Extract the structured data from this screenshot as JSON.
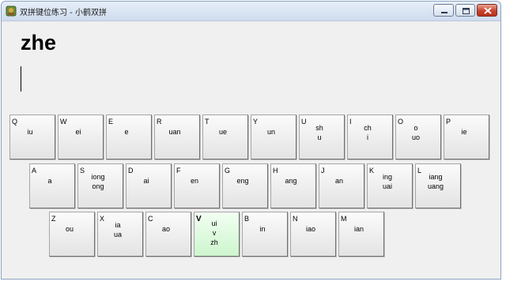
{
  "window": {
    "title": "双拼键位练习 - 小鹤双拼"
  },
  "practice": {
    "target_syllable": "zhe",
    "input_value": ""
  },
  "keyboard": {
    "active_key": "V",
    "rows": [
      [
        {
          "letter": "Q",
          "finals": [
            "iu"
          ]
        },
        {
          "letter": "W",
          "finals": [
            "ei"
          ]
        },
        {
          "letter": "E",
          "finals": [
            "e"
          ]
        },
        {
          "letter": "R",
          "finals": [
            "uan"
          ]
        },
        {
          "letter": "T",
          "finals": [
            "ue"
          ]
        },
        {
          "letter": "Y",
          "finals": [
            "un"
          ]
        },
        {
          "letter": "U",
          "finals": [
            "sh",
            "u"
          ]
        },
        {
          "letter": "I",
          "finals": [
            "ch",
            "i"
          ]
        },
        {
          "letter": "O",
          "finals": [
            "o",
            "uo"
          ]
        },
        {
          "letter": "P",
          "finals": [
            "ie"
          ]
        }
      ],
      [
        {
          "letter": "A",
          "finals": [
            "a"
          ]
        },
        {
          "letter": "S",
          "finals": [
            "iong",
            "ong"
          ]
        },
        {
          "letter": "D",
          "finals": [
            "ai"
          ]
        },
        {
          "letter": "F",
          "finals": [
            "en"
          ]
        },
        {
          "letter": "G",
          "finals": [
            "eng"
          ]
        },
        {
          "letter": "H",
          "finals": [
            "ang"
          ]
        },
        {
          "letter": "J",
          "finals": [
            "an"
          ]
        },
        {
          "letter": "K",
          "finals": [
            "ing",
            "uai"
          ]
        },
        {
          "letter": "L",
          "finals": [
            "iang",
            "uang"
          ]
        }
      ],
      [
        {
          "letter": "Z",
          "finals": [
            "ou"
          ]
        },
        {
          "letter": "X",
          "finals": [
            "ia",
            "ua"
          ]
        },
        {
          "letter": "C",
          "finals": [
            "ao"
          ]
        },
        {
          "letter": "V",
          "finals": [
            "ui",
            "v",
            "zh"
          ]
        },
        {
          "letter": "B",
          "finals": [
            "in"
          ]
        },
        {
          "letter": "N",
          "finals": [
            "iao"
          ]
        },
        {
          "letter": "M",
          "finals": [
            "ian"
          ]
        }
      ]
    ]
  },
  "colors": {
    "active_key_bg": "#cdf5cd",
    "window_bg": "#f0f0f0"
  }
}
